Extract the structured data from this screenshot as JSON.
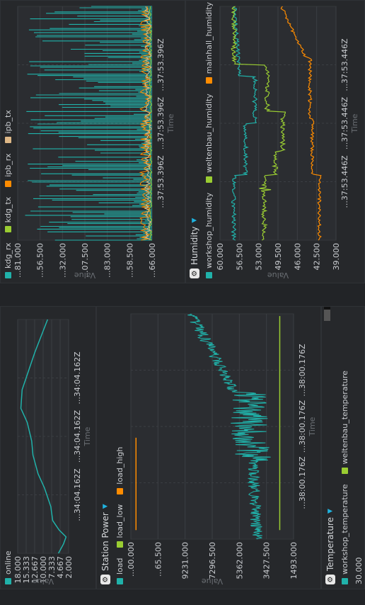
{
  "charts": [
    {
      "id": "online",
      "title": "",
      "legend": [
        {
          "label": "online",
          "color": "#20b2aa"
        }
      ],
      "chart_data": {
        "type": "line",
        "yticks": [
          "18.000",
          "15.333",
          "12.667",
          "10.000",
          "7.333",
          "4.667",
          "2.000"
        ],
        "ylim": [
          2,
          18
        ],
        "xticks": [
          "...34:04.162Z",
          "...34:04.162Z",
          "...34:04.162Z"
        ],
        "ylabel": "Value",
        "xlabel": "Time",
        "series": [
          {
            "name": "online",
            "color": "#20b2aa",
            "points": [
              [
                0.0,
                5.2
              ],
              [
                0.04,
                3.6
              ],
              [
                0.07,
                2.8
              ],
              [
                0.1,
                5.0
              ],
              [
                0.14,
                7.0
              ],
              [
                0.2,
                7.6
              ],
              [
                0.28,
                9.6
              ],
              [
                0.34,
                11.6
              ],
              [
                0.42,
                13.2
              ],
              [
                0.48,
                13.6
              ],
              [
                0.56,
                15.0
              ],
              [
                0.62,
                17.0
              ],
              [
                0.7,
                16.6
              ],
              [
                0.78,
                14.6
              ],
              [
                0.86,
                12.6
              ],
              [
                0.93,
                10.6
              ],
              [
                1.0,
                8.6
              ]
            ]
          }
        ]
      }
    },
    {
      "id": "station-power",
      "title": "Station Power",
      "legend": [
        {
          "label": "load",
          "color": "#20b2aa"
        },
        {
          "label": "load_low",
          "color": "#9acd32"
        },
        {
          "label": "load_high",
          "color": "#ff8c00"
        }
      ],
      "chart_data": {
        "type": "line",
        "yticks": [
          "...00.000",
          "...65.500",
          "9231.000",
          "7296.500",
          "5362.000",
          "3427.500",
          "1493.000"
        ],
        "ylim": [
          1493,
          11000
        ],
        "xticks": [
          "...38:00.176Z",
          "...38:00.176Z",
          "...38:00.176Z"
        ],
        "ylabel": "Value",
        "xlabel": "Time",
        "load_high": {
          "y": 10700,
          "x": [
            0.04,
            0.45
          ]
        },
        "load_low": {
          "y": 2300,
          "x": [
            0.04,
            0.99
          ]
        }
      }
    },
    {
      "id": "temperature",
      "title": "Temperature",
      "legend": [
        {
          "label": "workshop_temperature",
          "color": "#20b2aa"
        },
        {
          "label": "weltenbau_temperature",
          "color": "#9acd32"
        }
      ],
      "chart_data": {
        "type": "line",
        "yticks": [
          "30.000"
        ]
      }
    },
    {
      "id": "network",
      "title": "",
      "legend": [
        {
          "label": "kdg_rx",
          "color": "#20b2aa"
        },
        {
          "label": "kdg_tx",
          "color": "#9acd32"
        },
        {
          "label": "ipb_rx",
          "color": "#ff8c00"
        },
        {
          "label": "ipb_tx",
          "color": "#deb887"
        }
      ],
      "chart_data": {
        "type": "line",
        "yticks": [
          "...81.000",
          "...56.500",
          "...32.000",
          "...07.500",
          "...83.000",
          "...58.500",
          "...66.000"
        ],
        "xticks": [
          "...37:53.396Z",
          "...37:53.396Z",
          "...37:53.396Z"
        ],
        "ylabel": "Value",
        "xlabel": "Time"
      }
    },
    {
      "id": "humidity",
      "title": "Humidity",
      "legend": [
        {
          "label": "workshop_humidity",
          "color": "#20b2aa"
        },
        {
          "label": "weltenbau_humidity",
          "color": "#9acd32"
        },
        {
          "label": "mainhall_humidity",
          "color": "#ff8c00"
        }
      ],
      "chart_data": {
        "type": "line",
        "yticks": [
          "60.000",
          "56.500",
          "53.000",
          "49.500",
          "46.000",
          "42.500",
          "39.000"
        ],
        "ylim": [
          39,
          60
        ],
        "xticks": [
          "...37:53.446Z",
          "...37:53.446Z",
          "...37:53.446Z"
        ],
        "ylabel": "Value",
        "xlabel": "Time"
      }
    }
  ]
}
